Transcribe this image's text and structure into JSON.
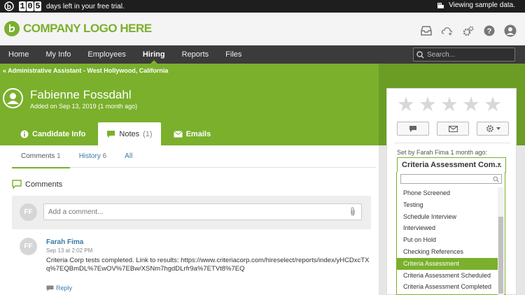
{
  "trial": {
    "days_digits": [
      "1",
      "0",
      "5"
    ],
    "text": "days left in your free trial.",
    "sample_text": "Viewing sample data."
  },
  "header": {
    "logo_text": "COMPANY LOGO HERE",
    "icons": [
      "inbox-icon",
      "cloud-upload-icon",
      "settings-icon",
      "help-icon",
      "user-avatar-icon"
    ]
  },
  "nav": {
    "items": [
      "Home",
      "My Info",
      "Employees",
      "Hiring",
      "Reports",
      "Files"
    ],
    "active": "Hiring",
    "search_placeholder": "Search..."
  },
  "breadcrumb": "« Administrative Assistant - West Hollywood, California",
  "candidate": {
    "name": "Fabienne Fossdahl",
    "added": "Added on Sep 13, 2019 (1 month ago)"
  },
  "tabs": {
    "info": "Candidate Info",
    "notes": "Notes",
    "notes_count": "(1)",
    "emails": "Emails"
  },
  "subtabs": {
    "comments": "Comments",
    "comments_count": "1",
    "history": "History",
    "history_count": "6",
    "all": "All"
  },
  "comments_section": {
    "title": "Comments",
    "avatar_initials": "FF",
    "input_placeholder": "Add a comment..."
  },
  "post": {
    "initials": "FF",
    "author": "Farah Fima",
    "date": "Sep 13 at 2:02 PM",
    "body": "Criteria Corp tests completed. Link to results: https://www.criteriacorp.com/hireselect/reports/index/yHCDxcTXq%7EQBmDL%7EwOV%7EBw/XSNm7hgdDLrfr9a%7ETVt8%7EQ",
    "reply": "Reply"
  },
  "panel": {
    "stars": 5,
    "rating": 0,
    "set_by": "Set by Farah Fima 1 month ago:",
    "status_value": "Criteria Assessment Com...",
    "options": [
      "Phone Screened",
      "Testing",
      "Schedule Interview",
      "Interviewed",
      "Put on Hold",
      "Checking References",
      "Criteria Assessment",
      "Criteria Assessment Scheduled",
      "Criteria Assessment Completed"
    ],
    "selected_option": "Criteria Assessment"
  },
  "colors": {
    "brand_green": "#7ab02c",
    "nav_dark": "#3b3b3b",
    "link_blue": "#3a79a8"
  }
}
